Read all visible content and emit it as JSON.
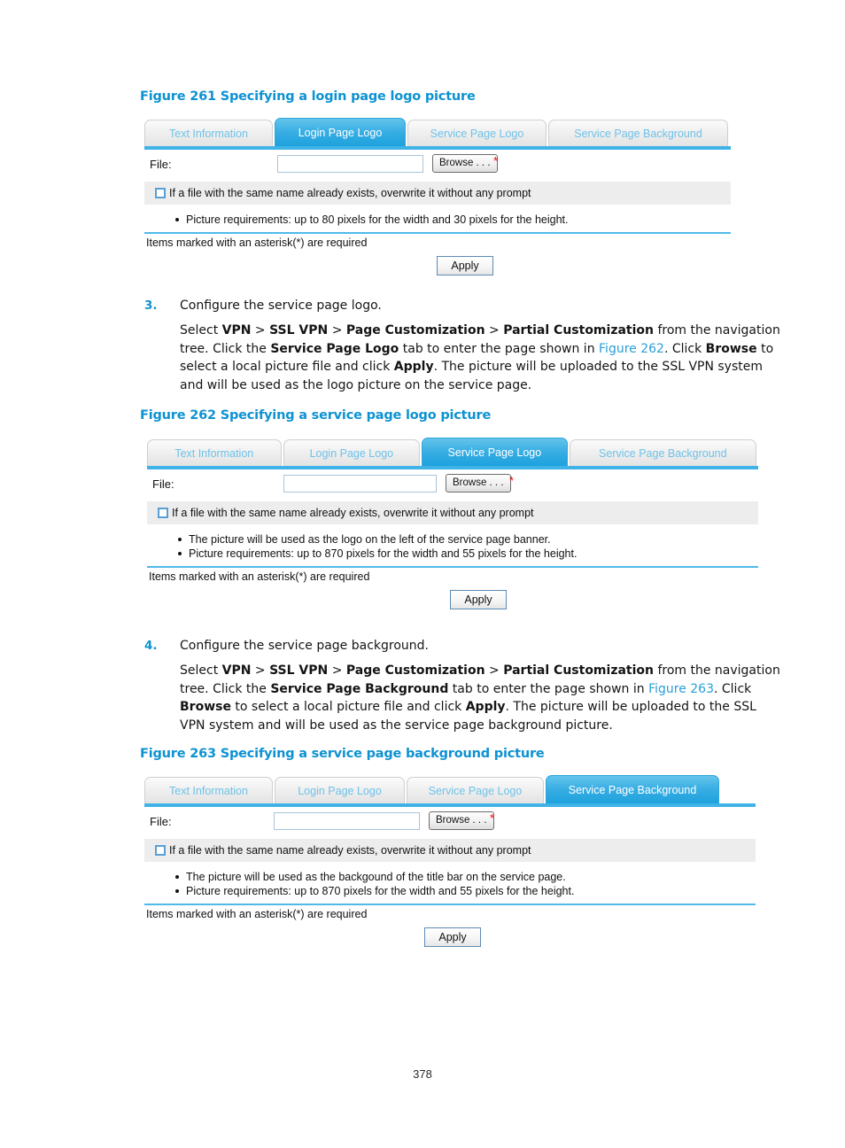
{
  "document": {
    "page_number": "378"
  },
  "figures": [
    {
      "caption": "Figure 261 Specifying a login page logo picture",
      "tabs": [
        {
          "label": "Text Information",
          "active": false
        },
        {
          "label": "Login Page Logo",
          "active": true
        },
        {
          "label": "Service Page Logo",
          "active": false
        },
        {
          "label": "Service Page Background",
          "active": false
        }
      ],
      "file_label": "File:",
      "file_value": "",
      "browse_label": "Browse . . .",
      "required_marker": "*",
      "overwrite_label": "If a file with the same name already exists, overwrite it without any prompt",
      "overwrite_checked": false,
      "notes": [
        "Picture requirements: up to 80 pixels for the width and 30 pixels for the height."
      ],
      "asterisk_note": "Items marked with an asterisk(*) are required",
      "apply_label": "Apply"
    },
    {
      "caption": "Figure 262 Specifying a service page logo picture",
      "tabs": [
        {
          "label": "Text Information",
          "active": false
        },
        {
          "label": "Login Page Logo",
          "active": false
        },
        {
          "label": "Service Page Logo",
          "active": true
        },
        {
          "label": "Service Page Background",
          "active": false
        }
      ],
      "file_label": "File:",
      "file_value": "",
      "browse_label": "Browse . . .",
      "required_marker": "*",
      "overwrite_label": "If a file with the same name already exists, overwrite it without any prompt",
      "overwrite_checked": false,
      "notes": [
        "The picture will be used as the logo on the left of the service page banner.",
        "Picture requirements: up to 870 pixels for the width and 55 pixels for the height."
      ],
      "asterisk_note": "Items marked with an asterisk(*) are required",
      "apply_label": "Apply"
    },
    {
      "caption": "Figure 263 Specifying a service page background picture",
      "tabs": [
        {
          "label": "Text Information",
          "active": false
        },
        {
          "label": "Login Page Logo",
          "active": false
        },
        {
          "label": "Service Page Logo",
          "active": false
        },
        {
          "label": "Service Page Background",
          "active": true
        }
      ],
      "file_label": "File:",
      "file_value": "",
      "browse_label": "Browse . . .",
      "required_marker": "*",
      "overwrite_label": "If a file with the same name already exists, overwrite it without any prompt",
      "overwrite_checked": false,
      "notes": [
        "The picture will be used as the backgound of the title bar on the service page.",
        "Picture requirements: up to 870 pixels for the width and 55 pixels for the height."
      ],
      "asterisk_note": "Items marked with an asterisk(*) are required",
      "apply_label": "Apply"
    }
  ],
  "steps": [
    {
      "number": "3.",
      "heading": "Configure the service page logo.",
      "body_parts": [
        {
          "text": "Select ",
          "style": "normal"
        },
        {
          "text": "VPN",
          "style": "bold"
        },
        {
          "text": " > ",
          "style": "normal"
        },
        {
          "text": "SSL VPN",
          "style": "bold"
        },
        {
          "text": " > ",
          "style": "normal"
        },
        {
          "text": "Page Customization",
          "style": "bold"
        },
        {
          "text": " > ",
          "style": "normal"
        },
        {
          "text": "Partial Customization",
          "style": "bold"
        },
        {
          "text": " from the navigation tree. Click the ",
          "style": "normal"
        },
        {
          "text": "Service Page Logo",
          "style": "bold"
        },
        {
          "text": " tab to enter the page shown in ",
          "style": "normal"
        },
        {
          "text": "Figure 262",
          "style": "xref"
        },
        {
          "text": ". Click ",
          "style": "normal"
        },
        {
          "text": "Browse",
          "style": "bold"
        },
        {
          "text": " to select a local picture file and click ",
          "style": "normal"
        },
        {
          "text": "Apply",
          "style": "bold"
        },
        {
          "text": ". The picture will be uploaded to the SSL VPN system and will be used as the logo picture on the service page.",
          "style": "normal"
        }
      ]
    },
    {
      "number": "4.",
      "heading": "Configure the service page background.",
      "body_parts": [
        {
          "text": "Select ",
          "style": "normal"
        },
        {
          "text": "VPN",
          "style": "bold"
        },
        {
          "text": " > ",
          "style": "normal"
        },
        {
          "text": "SSL VPN",
          "style": "bold"
        },
        {
          "text": " > ",
          "style": "normal"
        },
        {
          "text": "Page Customization",
          "style": "bold"
        },
        {
          "text": " > ",
          "style": "normal"
        },
        {
          "text": "Partial Customization",
          "style": "bold"
        },
        {
          "text": " from the navigation tree. Click the ",
          "style": "normal"
        },
        {
          "text": "Service Page Background",
          "style": "bold"
        },
        {
          "text": " tab to enter the page shown in ",
          "style": "normal"
        },
        {
          "text": "Figure 263",
          "style": "xref"
        },
        {
          "text": ". Click ",
          "style": "normal"
        },
        {
          "text": "Browse",
          "style": "bold"
        },
        {
          "text": " to select a local picture file and click ",
          "style": "normal"
        },
        {
          "text": "Apply",
          "style": "bold"
        },
        {
          "text": ". The picture will be uploaded to the SSL VPN system and will be used as the service page background picture.",
          "style": "normal"
        }
      ]
    }
  ],
  "colors": {
    "accent_blue": "#0d92d2",
    "tab_active": "#37ade3",
    "tab_inactive_text": "#6fc2e8",
    "rule_blue": "#4fb9ea",
    "required_red": "#ff0000",
    "row_gray": "#ededed"
  }
}
